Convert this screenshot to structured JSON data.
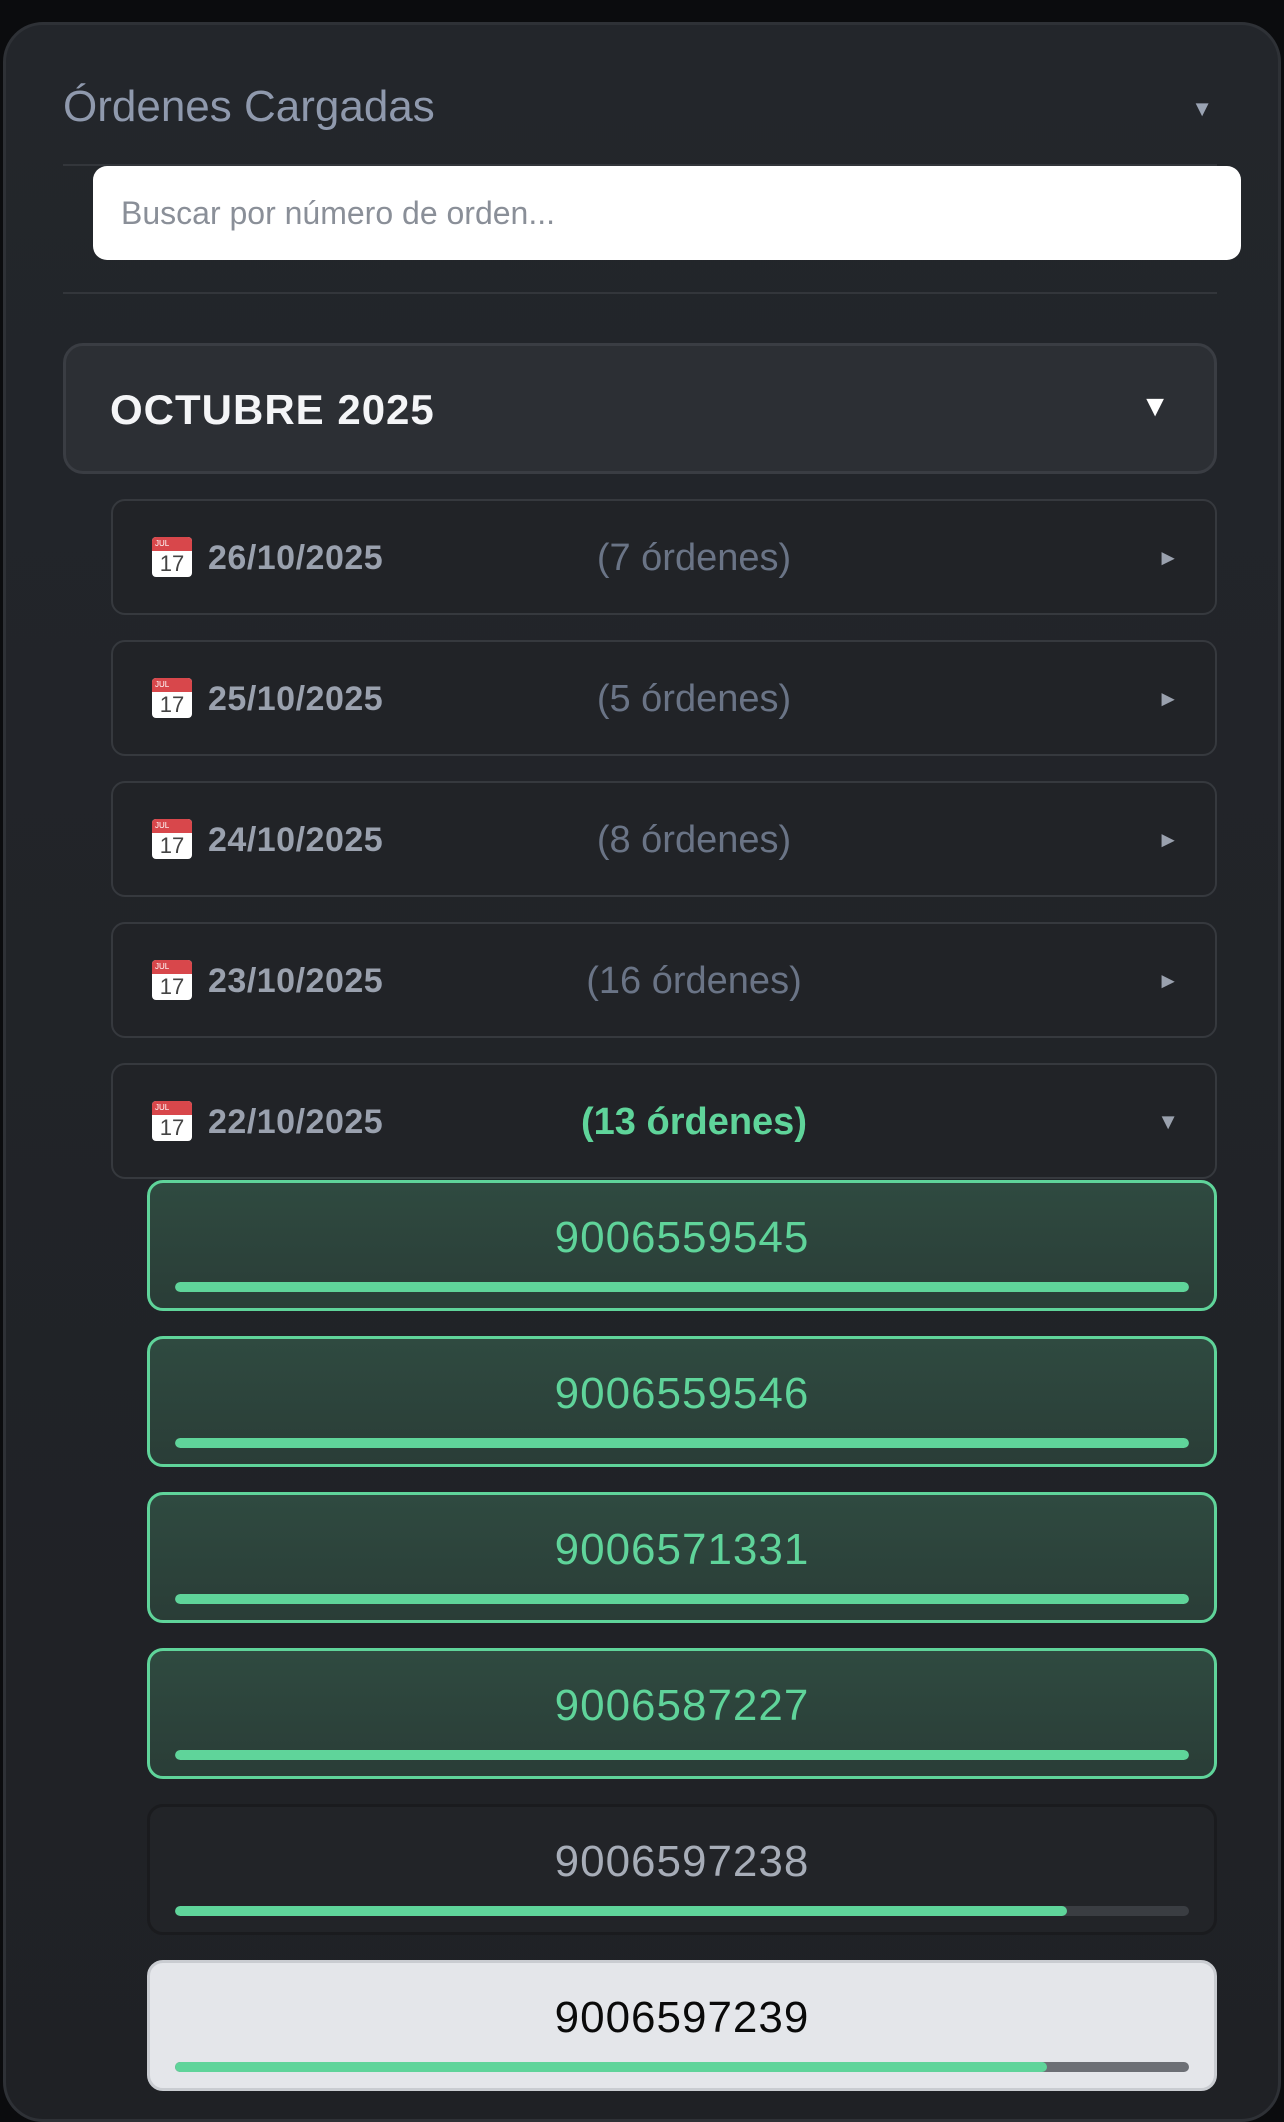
{
  "header": {
    "title": "Órdenes Cargadas",
    "toggle_icon": "▼"
  },
  "search": {
    "placeholder": "Buscar por número de orden..."
  },
  "month": {
    "label": "OCTUBRE 2025",
    "toggle_icon": "▼"
  },
  "days": [
    {
      "date": "26/10/2025",
      "count": "(7 órdenes)",
      "arrow": "►",
      "expanded": false
    },
    {
      "date": "25/10/2025",
      "count": "(5 órdenes)",
      "arrow": "►",
      "expanded": false
    },
    {
      "date": "24/10/2025",
      "count": "(8 órdenes)",
      "arrow": "►",
      "expanded": false
    },
    {
      "date": "23/10/2025",
      "count": "(16 órdenes)",
      "arrow": "►",
      "expanded": false
    },
    {
      "date": "22/10/2025",
      "count": "(13 órdenes)",
      "arrow": "▼",
      "expanded": true
    }
  ],
  "calendar_icon": {
    "month": "JUL",
    "day": "17"
  },
  "orders": [
    {
      "number": "9006559545",
      "progress": 1.0,
      "state": "done"
    },
    {
      "number": "9006559546",
      "progress": 1.0,
      "state": "done"
    },
    {
      "number": "9006571331",
      "progress": 1.0,
      "state": "done"
    },
    {
      "number": "9006587227",
      "progress": 1.0,
      "state": "done"
    },
    {
      "number": "9006597238",
      "progress": 0.88,
      "state": "partial"
    },
    {
      "number": "9006597239",
      "progress": 0.86,
      "state": "light"
    }
  ],
  "colors": {
    "accent_green": "#5fd49a",
    "panel_bg": "#23262b",
    "muted_text": "#6a7486"
  }
}
